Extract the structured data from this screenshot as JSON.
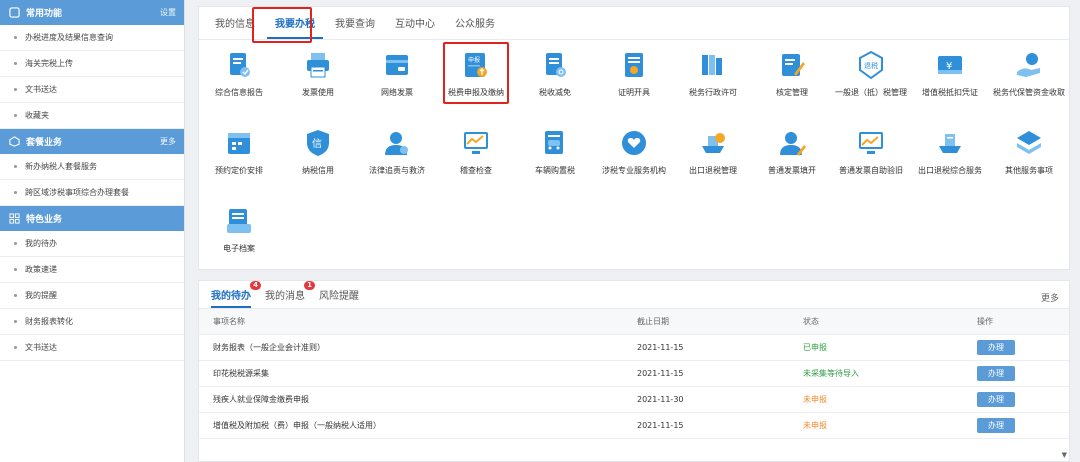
{
  "sidebar": {
    "sections": [
      {
        "title": "常用功能",
        "more": "设置",
        "icon": "grid-icon",
        "items": [
          "办税进度及结果信息查询",
          "海关完税上传",
          "文书送达",
          "收藏夹"
        ]
      },
      {
        "title": "套餐业务",
        "more": "更多",
        "icon": "package-icon",
        "items": [
          "新办纳税人套餐服务",
          "跨区域涉税事项综合办理套餐"
        ]
      },
      {
        "title": "特色业务",
        "more": "",
        "icon": "apps-icon",
        "items": [
          "我的待办",
          "政策速递",
          "我的提醒",
          "财务报表转化",
          "文书送达"
        ]
      }
    ]
  },
  "top_tabs": [
    "我的信息",
    "我要办税",
    "我要查询",
    "互动中心",
    "公众服务"
  ],
  "active_tab": 1,
  "services": [
    {
      "label": "综合信息报告",
      "icon": "report-icon",
      "color": "#2f8fd8"
    },
    {
      "label": "发票使用",
      "icon": "printer-icon",
      "color": "#2f8fd8"
    },
    {
      "label": "网络发票",
      "icon": "invoice-icon",
      "color": "#2f8fd8"
    },
    {
      "label": "税费申报及缴纳",
      "icon": "tax-filing-icon",
      "color": "#2f8fd8"
    },
    {
      "label": "税收减免",
      "icon": "tax-relief-icon",
      "color": "#2f8fd8"
    },
    {
      "label": "证明开具",
      "icon": "certificate-icon",
      "color": "#2f8fd8"
    },
    {
      "label": "税务行政许可",
      "icon": "folders-icon",
      "color": "#2f8fd8"
    },
    {
      "label": "核定管理",
      "icon": "edit-doc-icon",
      "color": "#2f8fd8"
    },
    {
      "label": "一般退（抵）税管理",
      "icon": "refund-icon",
      "color": "#2f8fd8"
    },
    {
      "label": "增值税抵扣凭证",
      "icon": "yen-ticket-icon",
      "color": "#2f8fd8"
    },
    {
      "label": "税务代保管资金收取",
      "icon": "money-hand-icon",
      "color": "#2f8fd8"
    },
    {
      "label": "预约定价安排",
      "icon": "calendar-icon",
      "color": "#2f8fd8"
    },
    {
      "label": "纳税信用",
      "icon": "credit-shield-icon",
      "color": "#2f8fd8"
    },
    {
      "label": "法律追责与救济",
      "icon": "user-law-icon",
      "color": "#2f8fd8"
    },
    {
      "label": "稽查检查",
      "icon": "monitor-chart-icon",
      "color": "#2f8fd8"
    },
    {
      "label": "车辆购置税",
      "icon": "car-doc-icon",
      "color": "#2f8fd8"
    },
    {
      "label": "涉税专业服务机构",
      "icon": "heart-hand-icon",
      "color": "#2f8fd8"
    },
    {
      "label": "出口退税管理",
      "icon": "ship-icon",
      "color": "#2f8fd8"
    },
    {
      "label": "普通发票填开",
      "icon": "user-pen-icon",
      "color": "#2f8fd8"
    },
    {
      "label": "普通发票自助验旧",
      "icon": "monitor-trend-icon",
      "color": "#2f8fd8"
    },
    {
      "label": "出口退税综合服务",
      "icon": "ship-doc-icon",
      "color": "#2f8fd8"
    },
    {
      "label": "其他服务事项",
      "icon": "layers-icon",
      "color": "#2f8fd8"
    },
    {
      "label": "电子档案",
      "icon": "archive-icon",
      "color": "#2f8fd8"
    }
  ],
  "highlighted_service": 3,
  "bottom_tabs": [
    {
      "label": "我的待办",
      "badge": "4"
    },
    {
      "label": "我的消息",
      "badge": "1"
    },
    {
      "label": "风险提醒",
      "badge": ""
    }
  ],
  "more_label": "更多",
  "table": {
    "headers": [
      "事项名称",
      "截止日期",
      "状态",
      "操作"
    ],
    "rows": [
      {
        "name": "财务报表（一般企业会计准则）",
        "date": "2021-11-15",
        "status": "已申报",
        "status_type": "done",
        "action": "办理"
      },
      {
        "name": "印花税税源采集",
        "date": "2021-11-15",
        "status": "未采集等待导入",
        "status_type": "wait",
        "action": "办理"
      },
      {
        "name": "残疾人就业保障金缴费申报",
        "date": "2021-11-30",
        "status": "未申报",
        "status_type": "not",
        "action": "办理"
      },
      {
        "name": "增值税及附加税（费）申报（一般纳税人适用）",
        "date": "2021-11-15",
        "status": "未申报",
        "status_type": "not",
        "action": "办理"
      }
    ]
  }
}
